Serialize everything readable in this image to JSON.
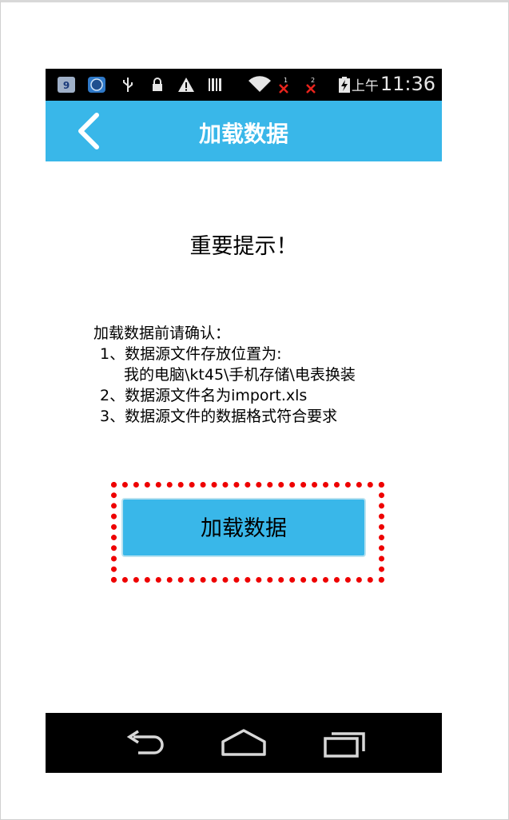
{
  "status_bar": {
    "time_ampm": "上午",
    "time": "11:36",
    "icons": [
      "app-icon",
      "clock-app-icon",
      "usb-icon",
      "lock-icon",
      "warning-icon",
      "barcode-icon",
      "wifi-icon",
      "no-signal-sim1-icon",
      "no-signal-sim2-icon",
      "battery-charging-icon"
    ],
    "sim1_label": "1",
    "sim2_label": "2"
  },
  "title_bar": {
    "title": "加载数据",
    "back_icon": "chevron-left-icon",
    "color": "#39b7e9"
  },
  "notice": {
    "title": "重要提示！",
    "intro": "加载数据前请确认：",
    "item1": "1、数据源文件存放位置为:",
    "item1_path": "我的电脑\\kt45\\手机存储\\电表换装",
    "item2": "2、数据源文件名为import.xls",
    "item3": "3、数据源文件的数据格式符合要求"
  },
  "action": {
    "load_button_label": "加载数据",
    "highlight_color": "#ee0000"
  },
  "nav_bar": {
    "icons": [
      "back-arrow-icon",
      "home-icon",
      "recent-apps-icon"
    ]
  }
}
